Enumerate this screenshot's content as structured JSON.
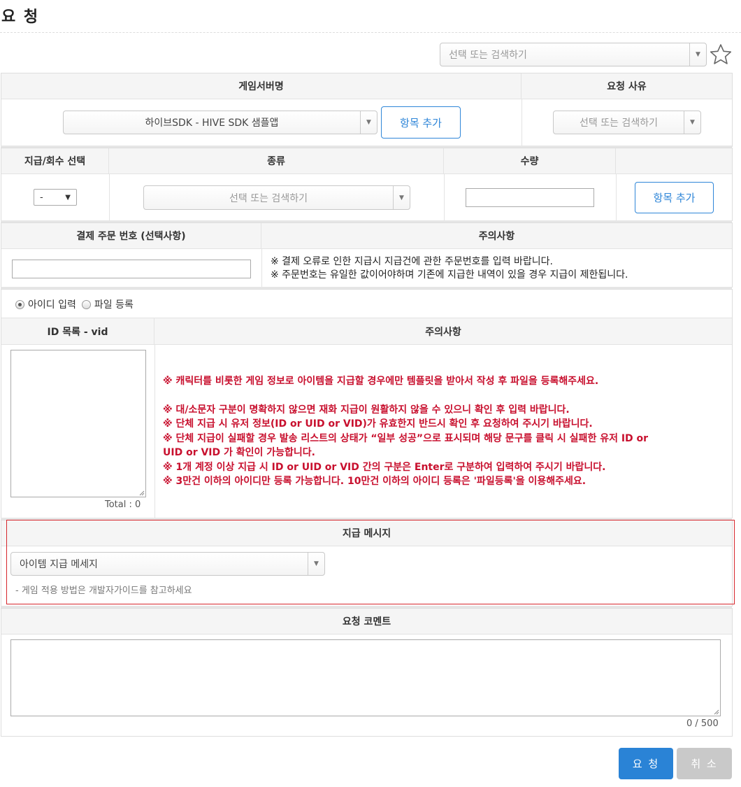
{
  "page": {
    "title": "요 청"
  },
  "top_search": {
    "placeholder": "선택 또는 검색하기"
  },
  "section1": {
    "server_header": "게임서버명",
    "reason_header": "요청 사유",
    "server_value": "하이브SDK - HIVE SDK 샘플앱",
    "add_button": "항목 추가",
    "reason_placeholder": "선택 또는 검색하기"
  },
  "section2": {
    "pay_header": "지급/회수 선택",
    "type_header": "종류",
    "qty_header": "수량",
    "pay_value": "-",
    "type_placeholder": "선택 또는 검색하기",
    "add_button": "항목 추가"
  },
  "section3": {
    "order_header": "결제 주문 번호 (선택사항)",
    "notice_header": "주의사항",
    "notice_line1": "※ 결제 오류로 인한 지급시 지급건에 관한 주문번호를 입력 바랍니다.",
    "notice_line2": "※ 주문번호는 유일한 값이어야하며 기존에 지급한 내역이 있을 경우 지급이 제한됩니다."
  },
  "section4": {
    "radio_id": "아이디 입력",
    "radio_file": "파일 등록",
    "id_list_header": "ID 목록 - vid",
    "notice_header": "주의사항",
    "total": "Total : 0",
    "notices": [
      "※ 캐릭터를 비롯한 게임 정보로 아이템을 지급할 경우에만 템플릿을 받아서 작성 후 파일을 등록해주세요.",
      "※ 대/소문자 구분이 명확하지 않으면 재화 지급이 원활하지 않을 수 있으니 확인 후 입력 바랍니다.",
      "※ 단체 지급 시 유저 정보(ID or UID or VID)가 유효한지 반드시 확인 후 요청하여 주시기 바랍니다.",
      "※ 단체 지급이 실패할 경우 발송 리스트의 상태가 “일부 성공”으로 표시되며 해당 문구를 클릭 시 실패한 유저 ID or",
      "UID or VID 가 확인이 가능합니다.",
      "※ 1개 계정 이상 지급 시 ID or UID or VID 간의 구분은 Enter로 구분하여 입력하여 주시기 바랍니다.",
      "※ 3만건 이하의 아이디만 등록 가능합니다. 10만건 이하의 아이디 등록은 '파일등록'을 이용해주세요."
    ]
  },
  "section5": {
    "header": "지급 메시지",
    "select_value": "아이템 지급 메세지",
    "hint": "- 게임 적용 방법은 개발자가이드를 참고하세요"
  },
  "section6": {
    "header": "요청 코멘트",
    "counter": "0 / 500"
  },
  "actions": {
    "request": "요 청",
    "cancel": "취 소"
  },
  "colors": {
    "primary": "#2a83d6",
    "warning": "#c8102e",
    "highlight_border": "#d6262c"
  }
}
